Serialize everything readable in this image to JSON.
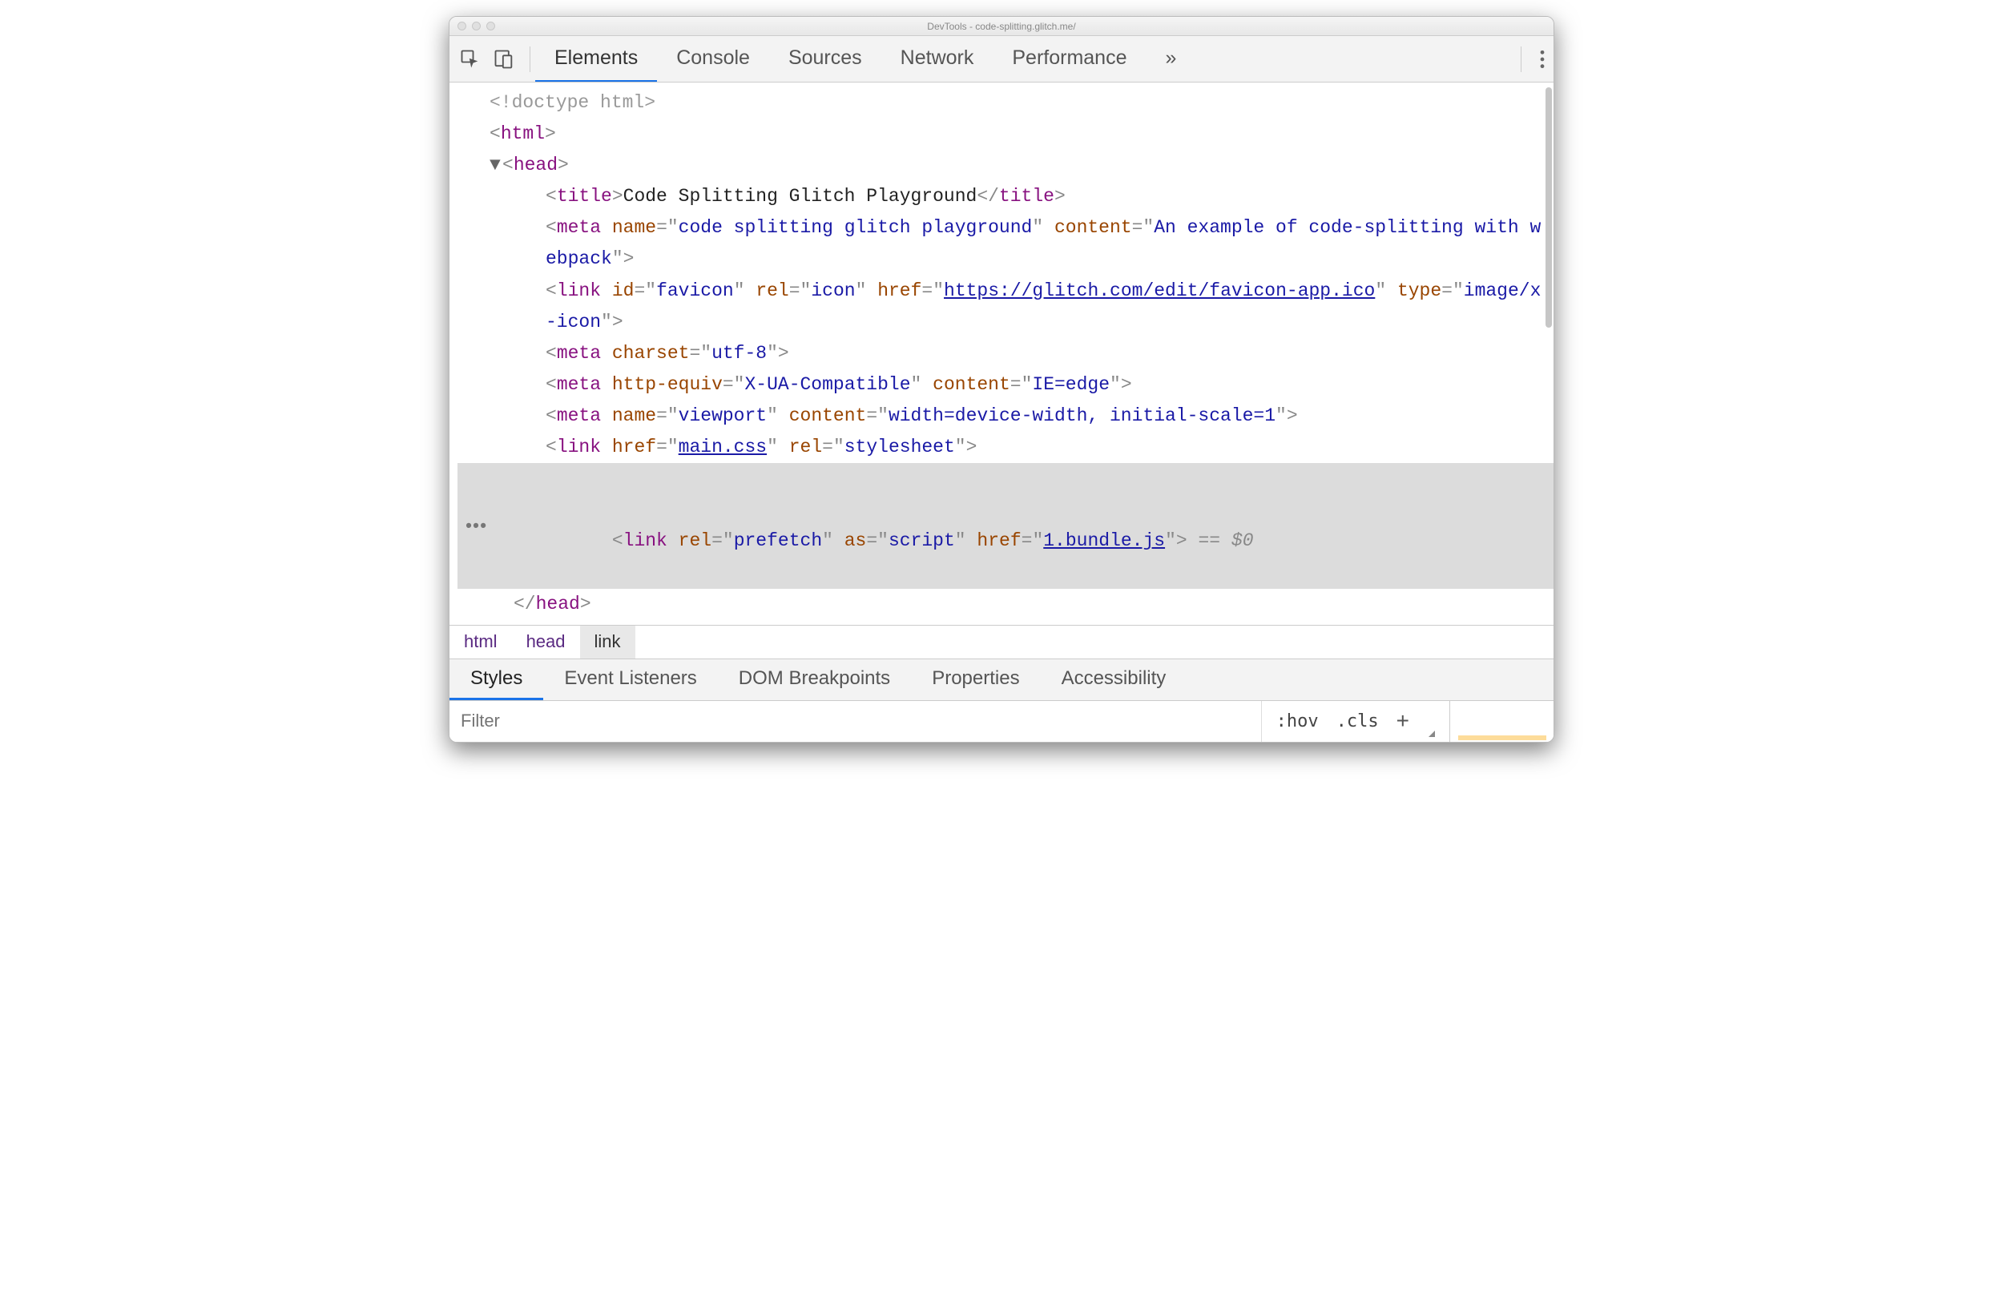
{
  "window": {
    "title": "DevTools - code-splitting.glitch.me/"
  },
  "tabs": {
    "elements": "Elements",
    "console": "Console",
    "sources": "Sources",
    "network": "Network",
    "performance": "Performance",
    "more": "»"
  },
  "dom": {
    "doctype": "<!doctype html>",
    "html_open": "html",
    "head_open": "head",
    "title_tag": "title",
    "title_text": "Code Splitting Glitch Playground",
    "meta1": {
      "tag": "meta",
      "name_attr": "name",
      "name_val": "code splitting glitch playground",
      "content_attr": "content",
      "content_val": "An example of code-splitting with webpack"
    },
    "link1": {
      "tag": "link",
      "id_attr": "id",
      "id_val": "favicon",
      "rel_attr": "rel",
      "rel_val": "icon",
      "href_attr": "href",
      "href_val": "https://glitch.com/edit/favicon-app.ico",
      "type_attr": "type",
      "type_val": "image/x-icon"
    },
    "meta2": {
      "tag": "meta",
      "charset_attr": "charset",
      "charset_val": "utf-8"
    },
    "meta3": {
      "tag": "meta",
      "he_attr": "http-equiv",
      "he_val": "X-UA-Compatible",
      "content_attr": "content",
      "content_val": "IE=edge"
    },
    "meta4": {
      "tag": "meta",
      "name_attr": "name",
      "name_val": "viewport",
      "content_attr": "content",
      "content_val": "width=device-width, initial-scale=1"
    },
    "link2": {
      "tag": "link",
      "href_attr": "href",
      "href_val": "main.css",
      "rel_attr": "rel",
      "rel_val": "stylesheet"
    },
    "link3": {
      "tag": "link",
      "rel_attr": "rel",
      "rel_val": "prefetch",
      "as_attr": "as",
      "as_val": "script",
      "href_attr": "href",
      "href_val": "1.bundle.js"
    },
    "sel_ref": " == $0",
    "head_close": "head"
  },
  "breadcrumb": {
    "html": "html",
    "head": "head",
    "link": "link"
  },
  "subtabs": {
    "styles": "Styles",
    "event_listeners": "Event Listeners",
    "dom_breakpoints": "DOM Breakpoints",
    "properties": "Properties",
    "accessibility": "Accessibility"
  },
  "stylesbar": {
    "filter_placeholder": "Filter",
    "hov": ":hov",
    "cls": ".cls",
    "plus": "+"
  }
}
